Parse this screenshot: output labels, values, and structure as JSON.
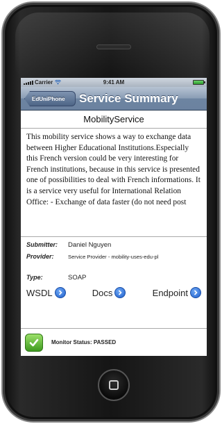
{
  "status_bar": {
    "carrier": "Carrier",
    "time": "9:41 AM"
  },
  "nav": {
    "back_label": "EdUniPhone",
    "title": "Service Summary"
  },
  "service": {
    "name": "MobilityService",
    "description": "This mobility service shows a way to exchange data between Higher Educational Institutions.Especially this French version could be very interesting for French institutions, because in this service is presented one of possibilities to deal with French informations. It is a service very useful for International Relation Office: - Exchange of data faster (do not need post"
  },
  "details": {
    "submitter_label": "Submitter:",
    "submitter_value": "Daniel Nguyen",
    "provider_label": "Provider:",
    "provider_value": "Service Provider - mobility-uses-edu-pl",
    "type_label": "Type:",
    "type_value": "SOAP"
  },
  "links": {
    "wsdl": "WSDL",
    "docs": "Docs",
    "endpoint": "Endpoint"
  },
  "monitor": {
    "status_text": "Monitor Status: PASSED"
  },
  "colors": {
    "nav_blue": "#6d84a1",
    "disclosure_blue": "#1f5fcc",
    "passed_green": "#3e9a1f"
  },
  "icons": {
    "disclosure": "chevron-right-circle-icon",
    "monitor": "check-icon"
  }
}
